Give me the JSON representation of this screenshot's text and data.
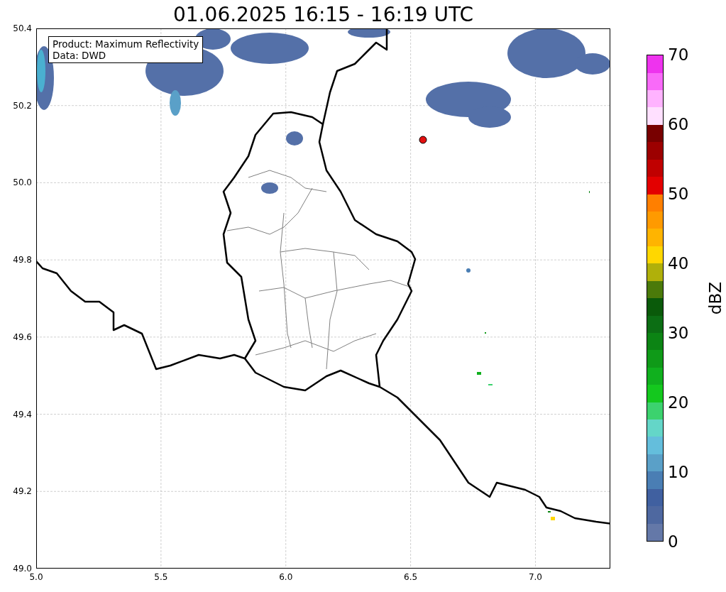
{
  "title": "01.06.2025 16:15 - 16:19 UTC",
  "info_box": {
    "lines": [
      "Product: Maximum Reflectivity",
      "Data: DWD"
    ]
  },
  "x_ticks": [
    "5.0",
    "5.5",
    "6.0",
    "6.5",
    "7.0"
  ],
  "y_ticks": [
    "50.4",
    "50.2",
    "50.0",
    "49.8",
    "49.6",
    "49.4",
    "49.2",
    "49.0"
  ],
  "colorbar": {
    "label": "dBZ",
    "ticks": [
      "70",
      "60",
      "50",
      "40",
      "30",
      "20",
      "10",
      "0"
    ],
    "segments": [
      {
        "color": "#6478a8"
      },
      {
        "color": "#4e68a0"
      },
      {
        "color": "#4060a0"
      },
      {
        "color": "#4a7eb4"
      },
      {
        "color": "#5aa0c8"
      },
      {
        "color": "#64bedc"
      },
      {
        "color": "#64d6c8"
      },
      {
        "color": "#3cd26e"
      },
      {
        "color": "#14c81e"
      },
      {
        "color": "#10b01e"
      },
      {
        "color": "#0f9a18"
      },
      {
        "color": "#0c8414"
      },
      {
        "color": "#0c6e14"
      },
      {
        "color": "#0a5a0a"
      },
      {
        "color": "#4b7a0a"
      },
      {
        "color": "#b0b00a"
      },
      {
        "color": "#ffd700"
      },
      {
        "color": "#ffb400"
      },
      {
        "color": "#ff9a00"
      },
      {
        "color": "#ff7f00"
      },
      {
        "color": "#e30000"
      },
      {
        "color": "#c00000"
      },
      {
        "color": "#9c0000"
      },
      {
        "color": "#780000"
      },
      {
        "color": "#ffe0ff"
      },
      {
        "color": "#ffb3ff"
      },
      {
        "color": "#f96af9"
      },
      {
        "color": "#ee33ee"
      }
    ]
  }
}
